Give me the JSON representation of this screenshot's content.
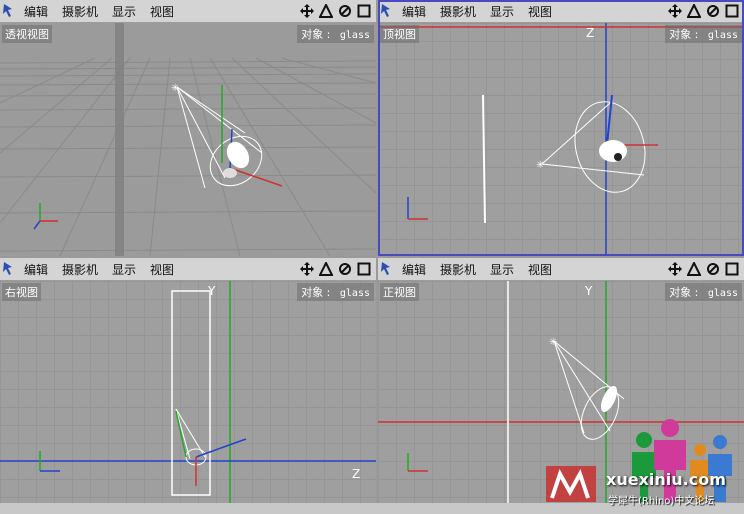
{
  "menu": {
    "edit": "编辑",
    "camera": "摄影机",
    "display": "显示",
    "view": "视图"
  },
  "viewports": {
    "perspective": {
      "label": "透视视图",
      "object_label": "对象 :",
      "object_name": "glass"
    },
    "top": {
      "label": "顶视图",
      "object_label": "对象 :",
      "object_name": "glass",
      "axis_z": "Z"
    },
    "right": {
      "label": "右视图",
      "object_label": "对象 :",
      "object_name": "glass",
      "axis_y": "Y",
      "axis_z": "Z"
    },
    "front": {
      "label": "正视图",
      "object_label": "对象 :",
      "object_name": "glass",
      "axis_y": "Y"
    }
  },
  "icons": [
    "camera-tool-icon",
    "move-icon",
    "rotate-icon",
    "scale-icon",
    "maximize-icon"
  ],
  "colors": {
    "x_axis": "#d23030",
    "y_axis": "#22aa22",
    "z_axis": "#2244cc",
    "active_view": "#4a4ac0"
  },
  "watermark": {
    "site": "xuexiniu.com",
    "sub": "学犀牛(Rhino)中文论坛"
  }
}
